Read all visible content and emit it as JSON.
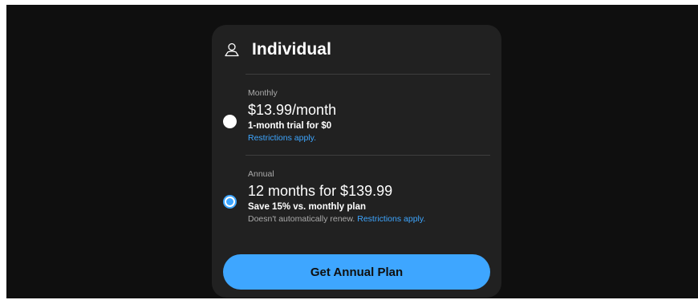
{
  "plan": {
    "title": "Individual",
    "icon": "person-icon"
  },
  "options": {
    "monthly": {
      "label": "Monthly",
      "price": "$13.99/month",
      "subtitle": "1-month trial for $0",
      "restrictions": "Restrictions apply.",
      "selected": false
    },
    "annual": {
      "label": "Annual",
      "price": "12 months for $139.99",
      "subtitle": "Save 15% vs. monthly plan",
      "note": "Doesn't automatically renew.",
      "restrictions": "Restrictions apply.",
      "selected": true
    }
  },
  "cta": {
    "label": "Get Annual Plan"
  },
  "colors": {
    "accent": "#3ea6ff",
    "card": "#212121",
    "background": "#0f0f0f"
  }
}
